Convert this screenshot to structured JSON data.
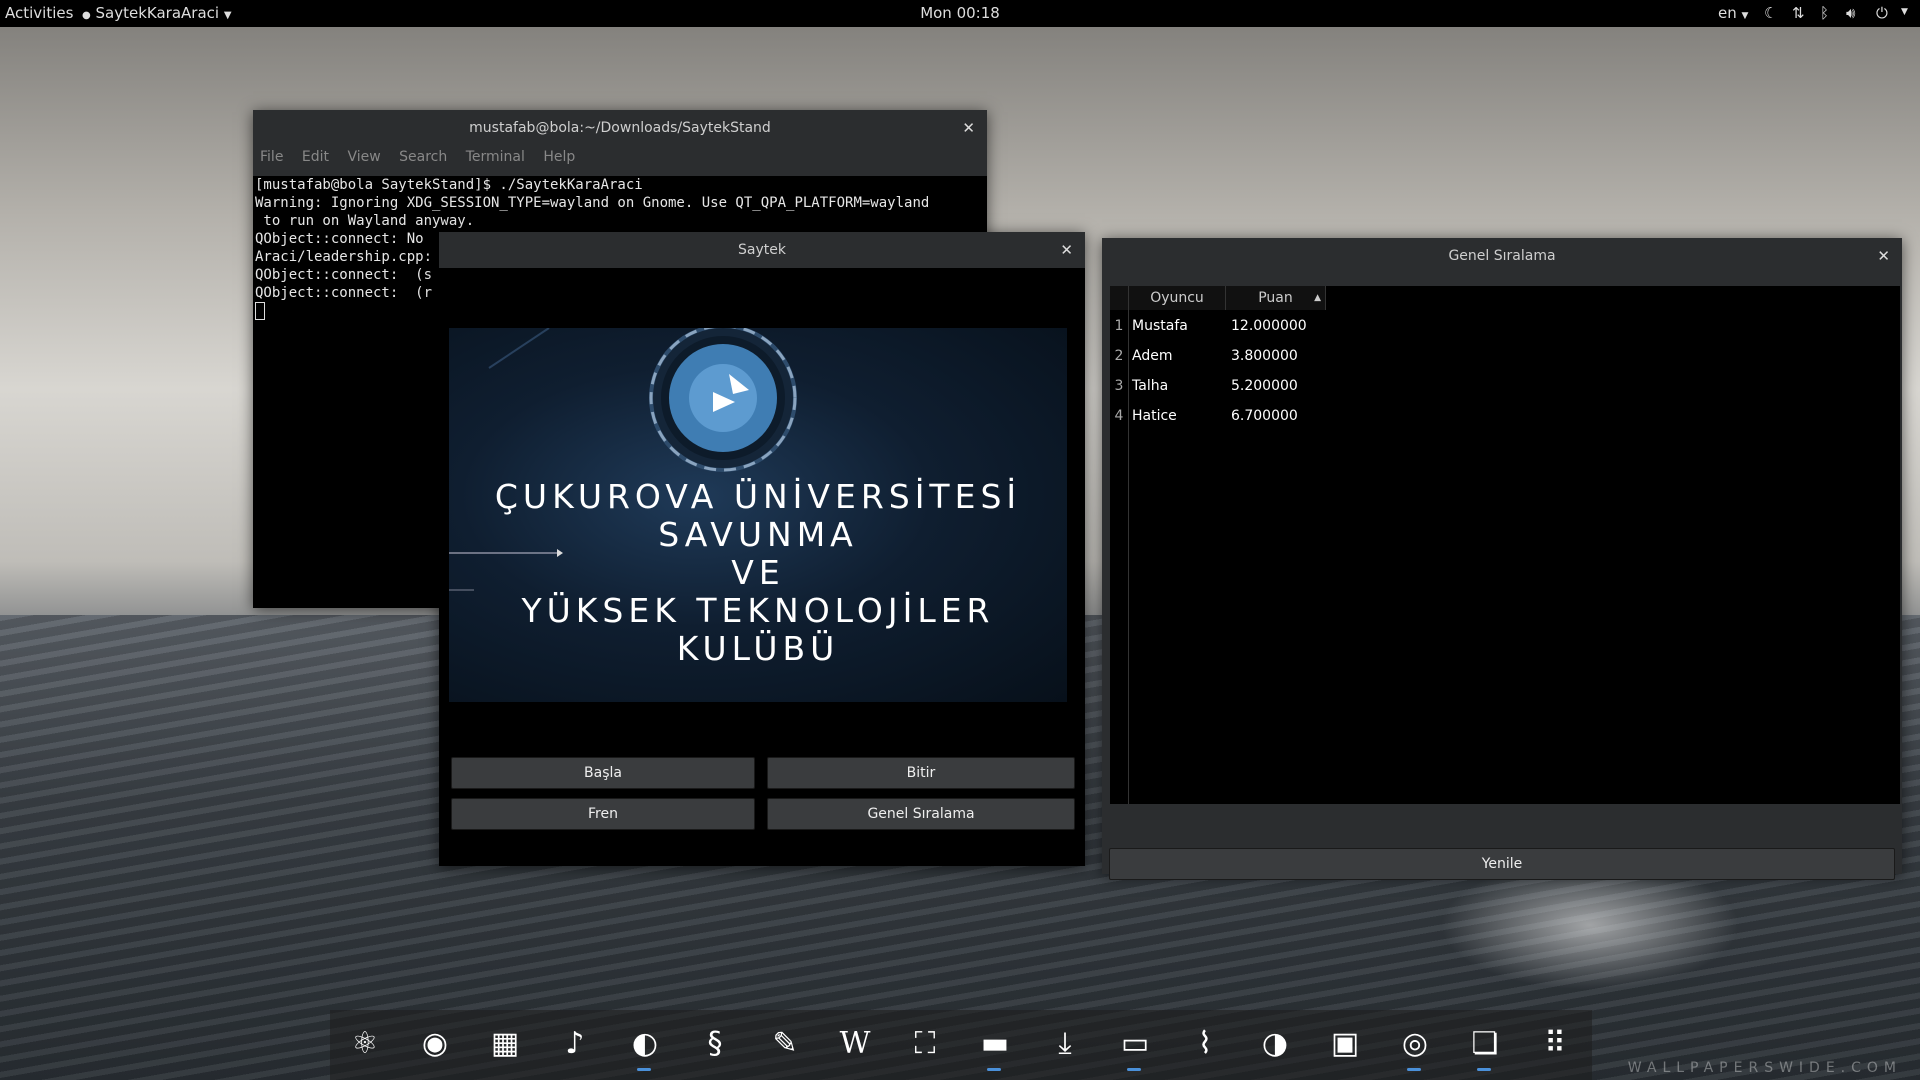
{
  "topbar": {
    "activities": "Activities",
    "app_name": "SaytekKaraAraci",
    "clock": "Mon 00:18",
    "lang": "en"
  },
  "terminal": {
    "title": "mustafab@bola:~/Downloads/SaytekStand",
    "menu": [
      "File",
      "Edit",
      "View",
      "Search",
      "Terminal",
      "Help"
    ],
    "lines": [
      "[mustafab@bola SaytekStand]$ ./SaytekKaraAraci",
      "Warning: Ignoring XDG_SESSION_TYPE=wayland on Gnome. Use QT_QPA_PLATFORM=wayland",
      " to run on Wayland anyway.",
      "QObject::connect: No",
      "Araci/leadership.cpp:",
      "QObject::connect:  (s",
      "QObject::connect:  (r"
    ]
  },
  "saytek": {
    "title": "Saytek",
    "banner_lines": [
      "ÇUKUROVA ÜNİVERSİTESİ",
      "SAVUNMA",
      "VE",
      "YÜKSEK TEKNOLOJİLER",
      "KULÜBÜ"
    ],
    "buttons": {
      "start": "Başla",
      "finish": "Bitir",
      "brake": "Fren",
      "ranking": "Genel Sıralama"
    }
  },
  "leaderboard": {
    "title": "Genel Sıralama",
    "columns": [
      "Oyuncu",
      "Puan"
    ],
    "rows": [
      {
        "num": "1",
        "player": "Mustafa",
        "score": "12.000000"
      },
      {
        "num": "2",
        "player": "Adem",
        "score": "3.800000"
      },
      {
        "num": "3",
        "player": "Talha",
        "score": "5.200000"
      },
      {
        "num": "4",
        "player": "Hatice",
        "score": "6.700000"
      }
    ],
    "refresh_button": "Yenile"
  },
  "dock": {
    "icons": [
      "atom-icon",
      "disc-icon",
      "calculator-icon",
      "music-note-icon",
      "firefox-icon",
      "swirl-icon",
      "pen-icon",
      "w-letter-icon",
      "screenshot-icon",
      "folder-icon",
      "download-icon",
      "terminal-icon",
      "system-monitor-icon",
      "toggle-icon",
      "drive-icon",
      "chrome-icon",
      "book-icon",
      "app-grid-icon"
    ]
  },
  "watermark": "WALLPAPERSWIDE.COM"
}
